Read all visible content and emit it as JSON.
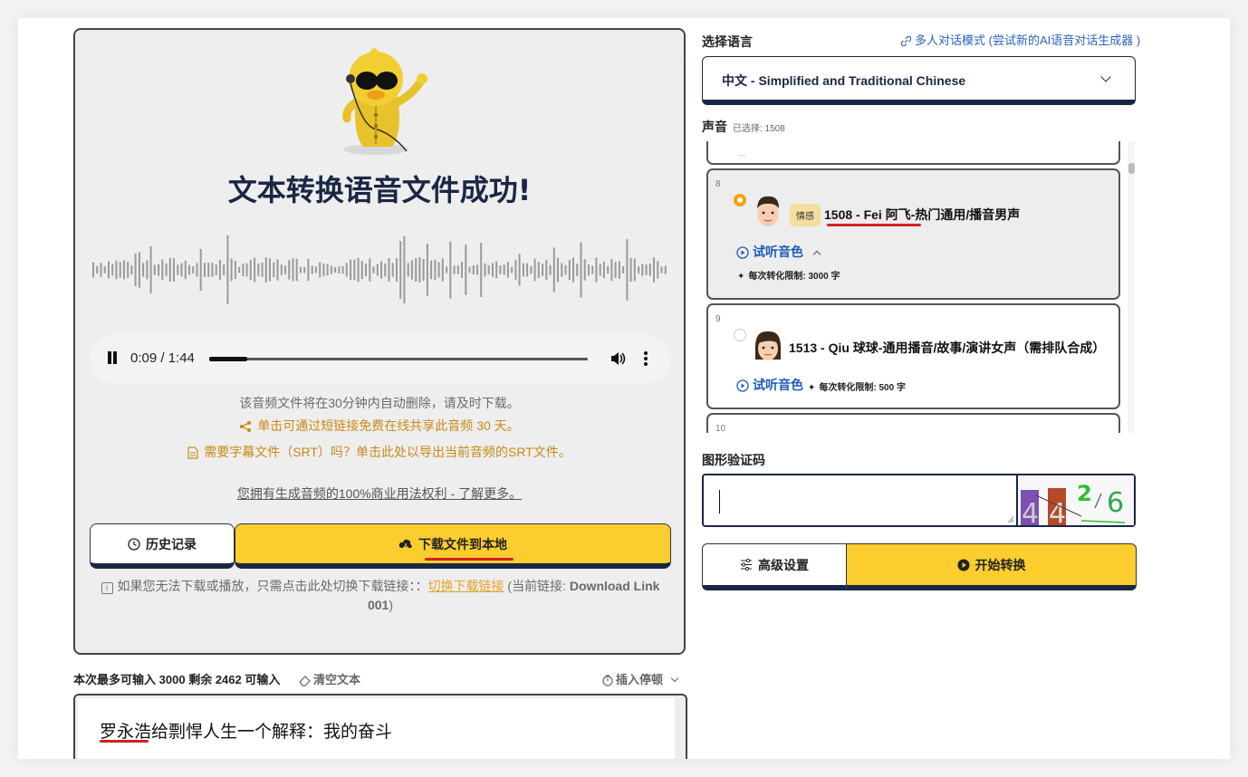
{
  "result": {
    "title": "文本转换语音文件成功!",
    "player": {
      "time": "0:09 / 1:44",
      "progress": 0.1
    },
    "notes": {
      "auto_delete": "该音频文件将在30分钟内自动删除，请及时下载。",
      "share": "单击可通过短链接免费在线共享此音频 30 天。",
      "srt": "需要字幕文件（SRT）吗？单击此处以导出当前音频的SRT文件。",
      "rights": "您拥有生成音频的100%商业用法权利 - 了解更多。"
    },
    "history_label": "历史记录",
    "download_label": "下载文件到本地",
    "switch_note": {
      "prefix": "如果您无法下载或播放，只需点击此处切换下载链接：：",
      "link": "切换下载链接",
      "current_open": " (当前链接: ",
      "current_value": "Download Link 001",
      "current_close": ")"
    }
  },
  "input": {
    "limit_prefix": "本次最多可输入",
    "max": "3000",
    "remain_label": "剩余",
    "remain": "2462",
    "remain_suffix": "可输入",
    "clear_label": "清空文本",
    "pause_label": "插入停顿",
    "text": "罗永浩给剽悍人生一个解释：我的奋斗"
  },
  "language": {
    "label": "选择语言",
    "multi_link": "多人对话模式 (尝试新的AI语音对话生成器 )",
    "selected": "中文 - Simplified and Traditional Chinese"
  },
  "voices": {
    "label": "声音",
    "selected_hint": "已选择: 1508",
    "partial_top_text": "...",
    "items": [
      {
        "index": "8",
        "tag": "情感",
        "name": "1508 - Fei 阿飞-热门通用/播音男声",
        "preview": "试听音色",
        "limit": "每次转化限制: 3000 字",
        "selected": true
      },
      {
        "index": "9",
        "tag": "",
        "name": "1513 - Qiu 球球-通用播音/故事/演讲女声（需排队合成）",
        "preview": "试听音色",
        "limit": "每次转化限制: 500 字",
        "selected": false
      },
      {
        "index": "10"
      }
    ]
  },
  "captcha": {
    "label": "图形验证码",
    "value": "",
    "image_text": "4426"
  },
  "actions": {
    "advanced_label": "高级设置",
    "start_label": "开始转换"
  },
  "colors": {
    "accent": "#fbcd2e",
    "navy": "#1a2744",
    "link_blue": "#1f5bb5",
    "orange": "#c98a16",
    "underline_red": "#d32020"
  }
}
